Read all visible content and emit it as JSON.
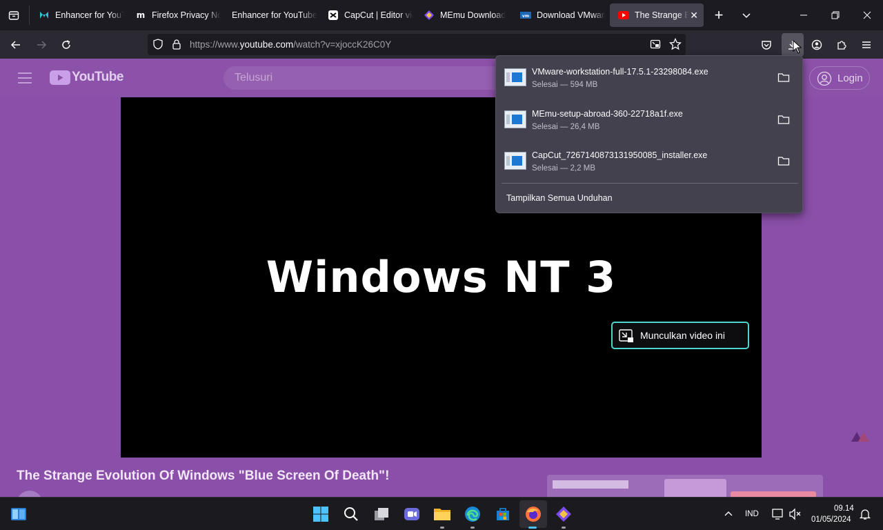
{
  "tabs": [
    {
      "label": "Enhancer for YouTube",
      "icon": "enhancer-icon"
    },
    {
      "label": "Firefox Privacy Notice",
      "icon": "mozilla-icon"
    },
    {
      "label": "Enhancer for YouTube",
      "icon": "page-icon"
    },
    {
      "label": "CapCut | Editor video",
      "icon": "capcut-icon"
    },
    {
      "label": "MEmu Download",
      "icon": "memu-icon"
    },
    {
      "label": "Download VMware",
      "icon": "vmware-icon"
    },
    {
      "label": "The Strange Evolution",
      "icon": "youtube-icon"
    }
  ],
  "url": {
    "prefix": "https://www.",
    "domain": "youtube.com",
    "path": "/watch?v=xjoccK26C0Y"
  },
  "youtube": {
    "logo_text": "YouTube",
    "search_placeholder": "Telusuri",
    "login_label": "Login",
    "video_text": "Windows NT 3",
    "pip_label": "Munculkan video ini",
    "page_title": "The Strange Evolution Of Windows \"Blue Screen Of Death\"!"
  },
  "downloads": {
    "items": [
      {
        "name": "VMware-workstation-full-17.5.1-23298084.exe",
        "status": "Selesai — 594 MB"
      },
      {
        "name": "MEmu-setup-abroad-360-22718a1f.exe",
        "status": "Selesai — 26,4 MB"
      },
      {
        "name": "CapCut_7267140873131950085_installer.exe",
        "status": "Selesai — 2,2 MB"
      }
    ],
    "show_all": "Tampilkan Semua Unduhan"
  },
  "taskbar": {
    "language": "IND",
    "time": "09.14",
    "date": "01/05/2024"
  },
  "colors": {
    "accent": "#4fd6d0",
    "page_bg": "#8a4fa8"
  }
}
